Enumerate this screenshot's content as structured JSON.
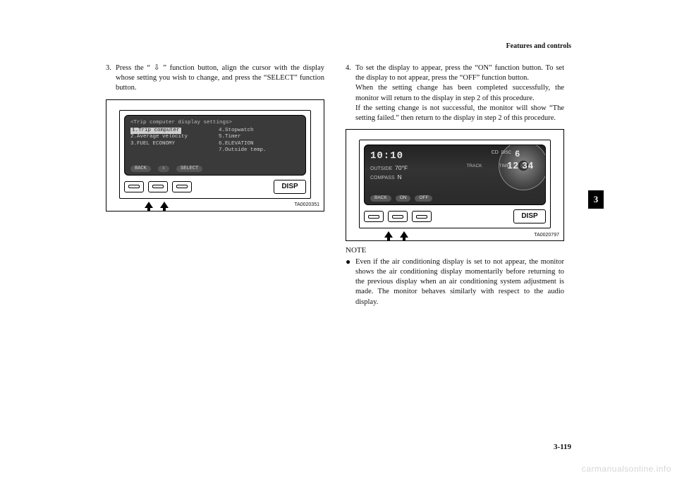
{
  "header": {
    "section": "Features and controls"
  },
  "side_tab": "3",
  "page_number": "3-119",
  "watermark": "carmanualsonline.info",
  "left": {
    "step_num": "3.",
    "step_text": "Press the “ ⇩ ” function button, align the cursor with the display whose setting you wish to change, and press the “SELECT” function button.",
    "figure": {
      "id": "TA0020351",
      "screen_title": "<Trip computer display settings>",
      "menu_left": [
        "1.Trip computer",
        "2.Average velocity",
        "3.FUEL ECONOMY"
      ],
      "menu_right": [
        "4.Stopwatch",
        "5.Timer",
        "6.ELEVATION",
        "7.Outside temp."
      ],
      "softkeys": [
        "BACK",
        "⇩",
        "SELECT"
      ],
      "disp": "DISP"
    }
  },
  "right": {
    "step_num": "4.",
    "step_text_a": "To set the display to appear, press the “ON” function button. To set the display to not appear, press the “OFF” function button.",
    "step_text_b": "When the setting change has been completed successfully, the monitor will return to the display in step 2 of this procedure.",
    "step_text_c": "If the setting change is not successful, the monitor will show “The setting failed.” then return to the display in step 2 of this procedure.",
    "figure": {
      "id": "TA0020797",
      "clock": "10:10",
      "outside_label": "OUTSIDE",
      "outside_val": "70°F",
      "compass_label": "COMPASS",
      "compass_val": "N",
      "cd_label": "CD",
      "disc_label": "DISC",
      "disc_num": "6",
      "track_label": "TRACK",
      "time_label": "TIME",
      "track_time": "12 34",
      "softkeys": [
        "BACK",
        "ON",
        "OFF"
      ],
      "disp": "DISP"
    },
    "note_head": "NOTE",
    "note_bullet": "Even if the air conditioning display is set to not appear, the monitor shows the air conditioning display momentarily before returning to the previous display when an air conditioning system adjustment is made. The monitor behaves similarly with respect to the audio display."
  }
}
